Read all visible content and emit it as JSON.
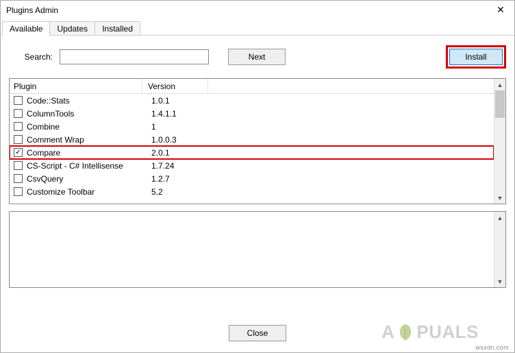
{
  "window": {
    "title": "Plugins Admin",
    "close_glyph": "✕"
  },
  "tabs": [
    {
      "label": "Available",
      "active": true
    },
    {
      "label": "Updates",
      "active": false
    },
    {
      "label": "Installed",
      "active": false
    }
  ],
  "search": {
    "label": "Search:",
    "value": "",
    "next_label": "Next",
    "install_label": "Install"
  },
  "columns": {
    "plugin": "Plugin",
    "version": "Version"
  },
  "plugins": [
    {
      "name": "Code::Stats",
      "version": "1.0.1",
      "checked": false,
      "highlight": false
    },
    {
      "name": "ColumnTools",
      "version": "1.4.1.1",
      "checked": false,
      "highlight": false
    },
    {
      "name": "Combine",
      "version": "1",
      "checked": false,
      "highlight": false
    },
    {
      "name": "Comment Wrap",
      "version": "1.0.0.3",
      "checked": false,
      "highlight": false
    },
    {
      "name": "Compare",
      "version": "2.0.1",
      "checked": true,
      "highlight": true
    },
    {
      "name": "CS-Script - C# Intellisense",
      "version": "1.7.24",
      "checked": false,
      "highlight": false
    },
    {
      "name": "CsvQuery",
      "version": "1.2.7",
      "checked": false,
      "highlight": false
    },
    {
      "name": "Customize Toolbar",
      "version": "5.2",
      "checked": false,
      "highlight": false
    }
  ],
  "bottom": {
    "close_label": "Close"
  },
  "watermark": "wsxdn.com",
  "brand": {
    "before": "A",
    "after": "PUALS"
  }
}
